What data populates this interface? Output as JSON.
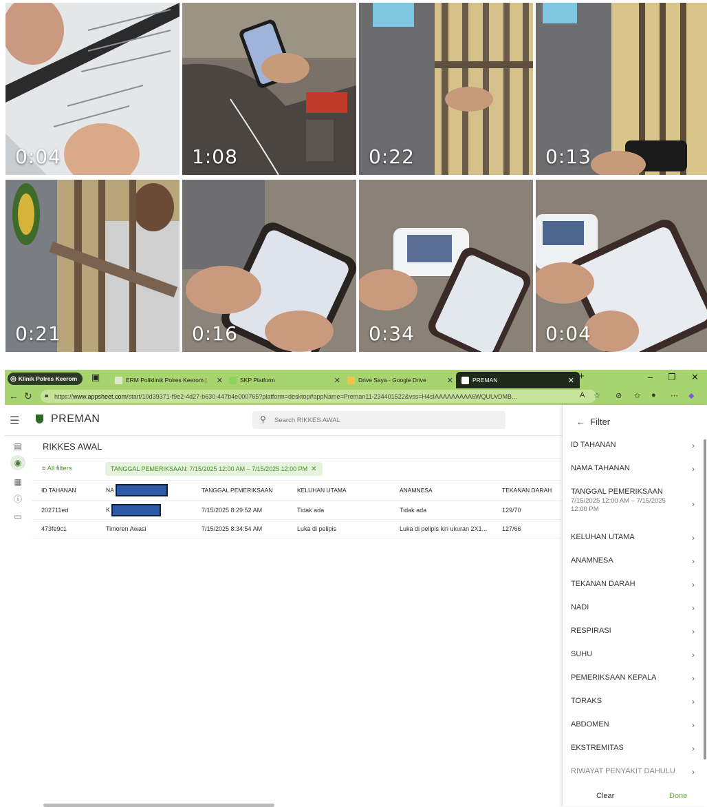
{
  "videos": [
    {
      "duration": "0:04"
    },
    {
      "duration": "1:08"
    },
    {
      "duration": "0:22"
    },
    {
      "duration": "0:13"
    },
    {
      "duration": "0:21"
    },
    {
      "duration": "0:16"
    },
    {
      "duration": "0:34"
    },
    {
      "duration": "0:04"
    }
  ],
  "browser": {
    "tabs": [
      {
        "label": "Klinik Polres Keerom"
      },
      {
        "label": "ERM Poliklinik Polres Keerom |"
      },
      {
        "label": "SKP Platform"
      },
      {
        "label": "Drive Saya - Google Drive"
      },
      {
        "label": "PREMAN"
      }
    ],
    "url_prefix": "https://",
    "url_domain": "www.appsheet.com",
    "url_rest": "/start/10d39371-f9e2-4d27-b630-447b4e000765?platform=desktop#appName=Preman11-234401522&vss=H4sIAAAAAAAAA6WQUUvDMB..."
  },
  "app": {
    "name": "PREMAN",
    "search_placeholder": "Search RIKKES AWAL",
    "view_title": "RIKKES AWAL",
    "all_filters": "All filters",
    "active_filter": "TANGGAL PEMERIKSAAN: 7/15/2025 12:00 AM – 7/15/2025 12:00 PM",
    "columns": [
      "ID TAHANAN",
      "NA",
      "TANGGAL PEMERIKSAAN",
      "KELUHAN UTAMA",
      "ANAMNESA",
      "TEKANAN DARAH"
    ],
    "rows": [
      [
        "202711ed",
        "K",
        "7/15/2025 8:29:52 AM",
        "Tidak ada",
        "Tidak ada",
        "129/70"
      ],
      [
        "473fe9c1",
        "Timoren Awasi",
        "7/15/2025 8:34:54 AM",
        "Luka di pelipis",
        "Luka di pelipis kiri ukuran 2X1...",
        "127/66"
      ]
    ]
  },
  "filter_panel": {
    "title": "Filter",
    "items": [
      {
        "label": "ID TAHANAN",
        "sub": ""
      },
      {
        "label": "NAMA TAHANAN",
        "sub": ""
      },
      {
        "label": "TANGGAL PEMERIKSAAN",
        "sub": "7/15/2025 12:00 AM – 7/15/2025 12:00 PM"
      },
      {
        "label": "KELUHAN UTAMA",
        "sub": ""
      },
      {
        "label": "ANAMNESA",
        "sub": ""
      },
      {
        "label": "TEKANAN DARAH",
        "sub": ""
      },
      {
        "label": "NADI",
        "sub": ""
      },
      {
        "label": "RESPIRASI",
        "sub": ""
      },
      {
        "label": "SUHU",
        "sub": ""
      },
      {
        "label": "PEMERIKSAAN KEPALA",
        "sub": ""
      },
      {
        "label": "TORAKS",
        "sub": ""
      },
      {
        "label": "ABDOMEN",
        "sub": ""
      },
      {
        "label": "EKSTREMITAS",
        "sub": ""
      },
      {
        "label": "RIWAYAT PENYAKIT DAHULU",
        "sub": ""
      }
    ],
    "clear_label": "Clear",
    "done_label": "Done"
  },
  "colors": {
    "accent": "#4a8d2a",
    "tabbar": "#a8d46f"
  }
}
